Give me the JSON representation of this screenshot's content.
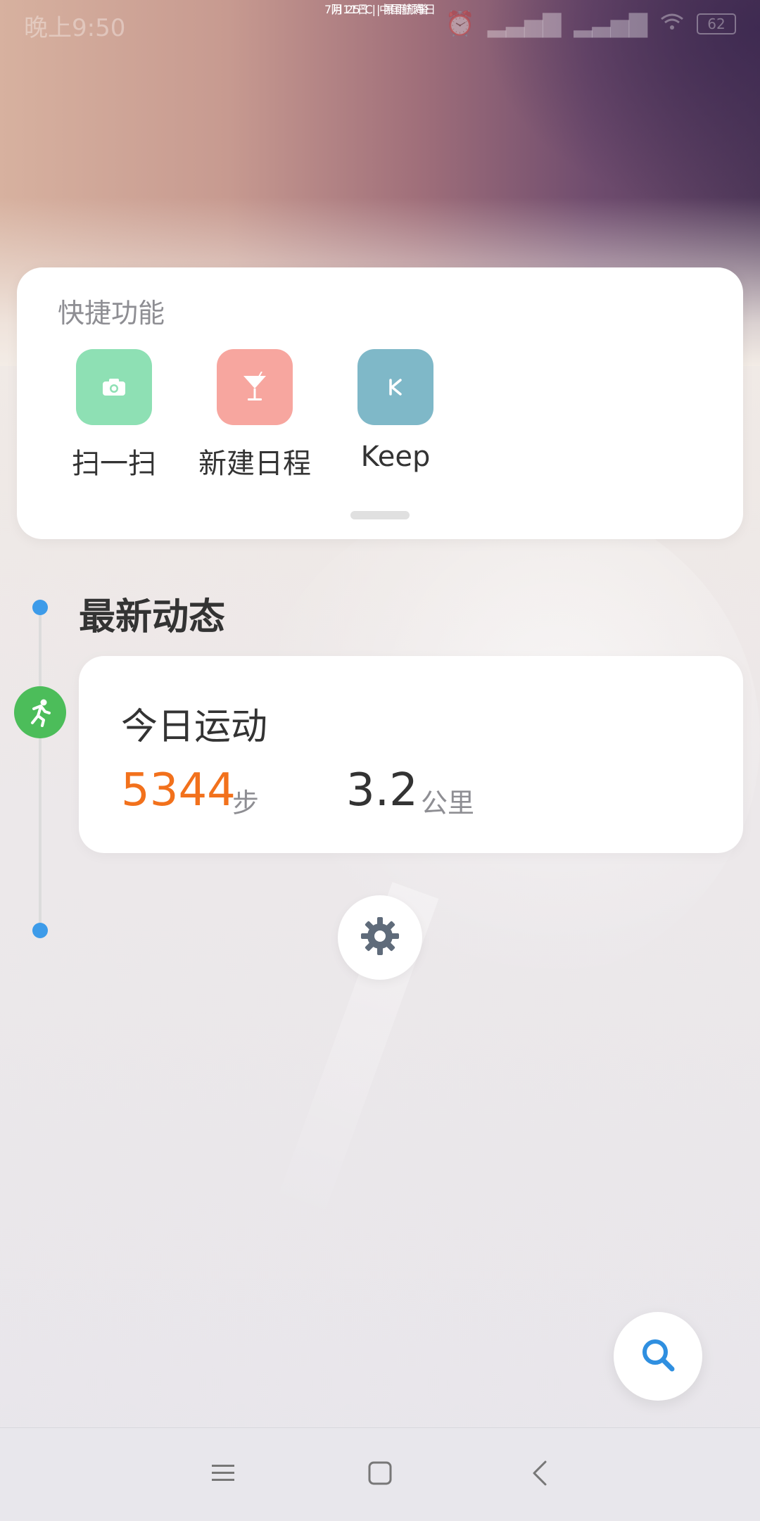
{
  "status_bar": {
    "time": "晚上9:50",
    "battery": "62"
  },
  "weather": {
    "summary": "阴  25℃  |  暴雨预警",
    "date_line": "7月11日 | 中国航海日"
  },
  "quick_functions": {
    "title": "快捷功能",
    "items": [
      {
        "label": "扫一扫",
        "icon": "camera-icon",
        "color": "#8ee0b4"
      },
      {
        "label": "新建日程",
        "icon": "cocktail-icon",
        "color": "#f7a69f"
      },
      {
        "label": "Keep",
        "icon": "keep-logo-icon",
        "color": "#7fb8c8"
      }
    ]
  },
  "feed": {
    "title": "最新动态",
    "sport_card": {
      "title": "今日运动",
      "steps": "5344",
      "steps_unit": "步",
      "distance": "3.2",
      "distance_unit": "公里"
    }
  },
  "colors": {
    "accent_blue": "#3d9be9",
    "steps_orange": "#f2711c",
    "run_green": "#4cbd5a"
  }
}
